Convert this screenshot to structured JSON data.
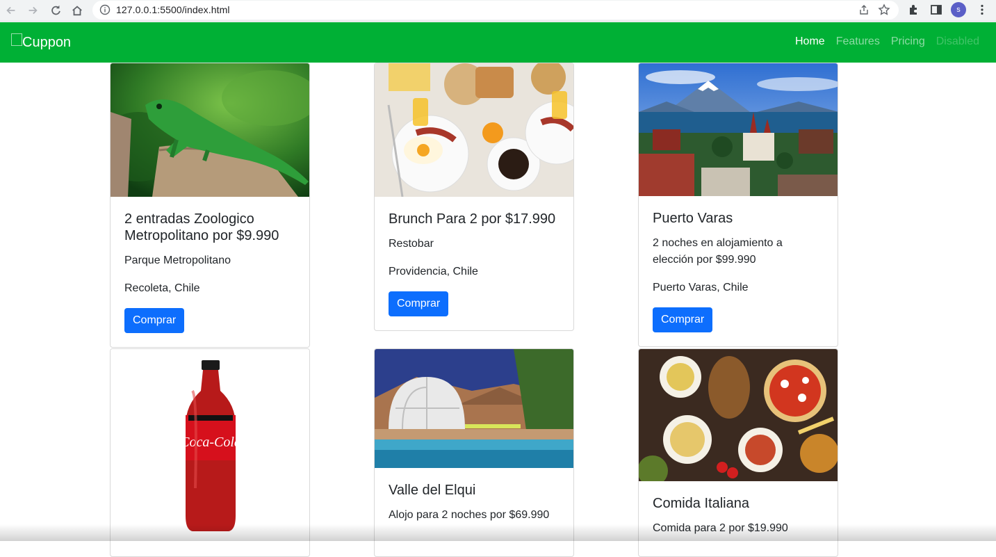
{
  "browser": {
    "url": "127.0.0.1:5500/index.html",
    "profile_initial": "s"
  },
  "navbar": {
    "brand": "Cuppon",
    "links": [
      {
        "label": "Home"
      },
      {
        "label": "Features"
      },
      {
        "label": "Pricing"
      },
      {
        "label": "Disabled"
      }
    ]
  },
  "colors": {
    "navbar_bg": "#00b035",
    "button_bg": "#0d6efd"
  },
  "cards": [
    {
      "title": "2 entradas Zoologico Metropolitano por $9.990",
      "subtitle": "Parque Metropolitano",
      "location": "Recoleta, Chile",
      "button": "Comprar"
    },
    {
      "title": "Brunch Para 2 por $17.990",
      "subtitle": "Restobar",
      "location": "Providencia, Chile",
      "button": "Comprar"
    },
    {
      "title": "Puerto Varas",
      "subtitle": "2 noches en alojamiento a elección por $99.990",
      "location": "Puerto Varas, Chile",
      "button": "Comprar"
    },
    {
      "title": "Valle del Elqui",
      "subtitle": "Alojo para 2 noches por $69.990"
    },
    {
      "title": "Comida Italiana",
      "subtitle": "Comida para 2 por $19.990"
    }
  ]
}
